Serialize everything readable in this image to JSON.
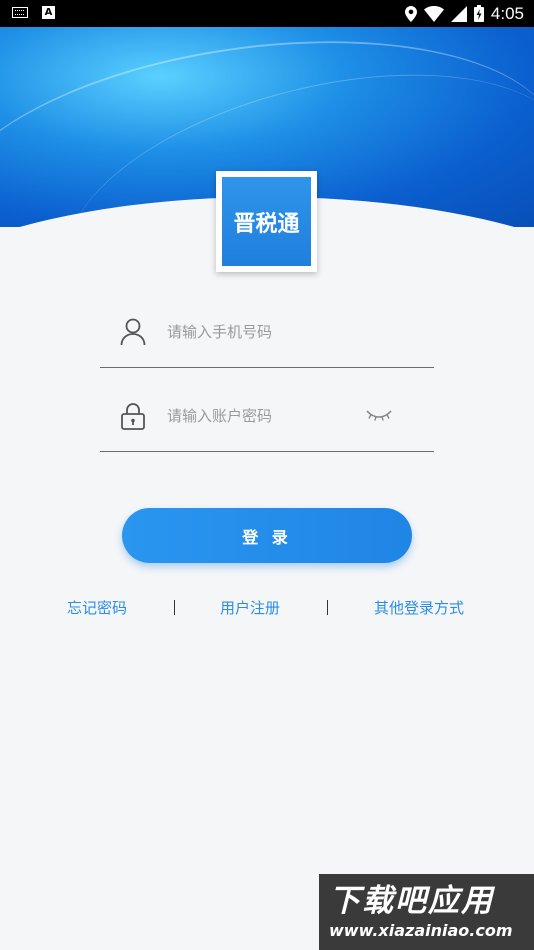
{
  "status_bar": {
    "time": "4:05",
    "left_icons": [
      "keyboard-icon",
      "text-a-icon"
    ],
    "right_icons": [
      "location-icon",
      "wifi-icon",
      "signal-icon",
      "battery-charging-icon"
    ]
  },
  "logo": {
    "text": "晋税通"
  },
  "phone_input": {
    "placeholder": "请输入手机号码",
    "value": "",
    "icon": "user-icon"
  },
  "password_input": {
    "placeholder": "请输入账户密码",
    "value": "",
    "icon": "lock-icon",
    "toggle_icon": "eye-closed-icon"
  },
  "login_button": {
    "label": "登 录"
  },
  "links": {
    "forgot_password": "忘记密码",
    "register": "用户注册",
    "other_login": "其他登录方式"
  },
  "watermark": {
    "title": "下载吧应用",
    "url": "www.xiazainiao.com"
  },
  "colors": {
    "accent": "#1f85e6",
    "link": "#2b8de6",
    "background": "#f5f6f8"
  }
}
